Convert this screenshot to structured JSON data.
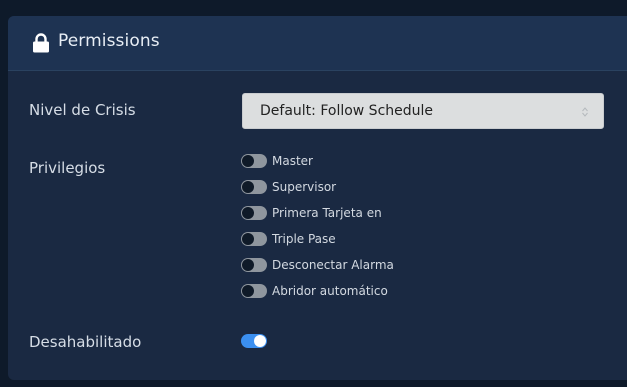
{
  "panel": {
    "title": "Permissions",
    "icon": "lock-icon"
  },
  "crisis_level": {
    "label": "Nivel de Crisis",
    "selected_value": "Default: Follow Schedule"
  },
  "privileges": {
    "label": "Privilegios",
    "items": [
      {
        "label": "Master",
        "enabled": false
      },
      {
        "label": "Supervisor",
        "enabled": false
      },
      {
        "label": "Primera Tarjeta en",
        "enabled": false
      },
      {
        "label": "Triple Pase",
        "enabled": false
      },
      {
        "label": "Desconectar Alarma",
        "enabled": false
      },
      {
        "label": "Abridor automático",
        "enabled": false
      }
    ]
  },
  "disabled": {
    "label": "Desahabilitado",
    "enabled": true
  },
  "colors": {
    "panel_background": "#1a2942",
    "header_background": "#1e3352",
    "toggle_on": "#3b8ff0",
    "toggle_off": "#8f969e"
  }
}
